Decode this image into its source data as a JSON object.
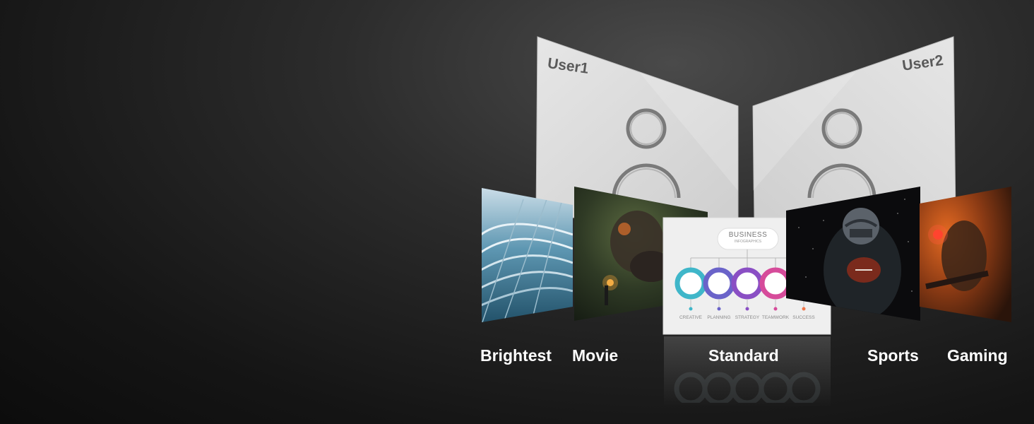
{
  "users": [
    {
      "label": "User1"
    },
    {
      "label": "User2"
    }
  ],
  "modes": [
    {
      "label": "Brightest",
      "image": "architecture-photo"
    },
    {
      "label": "Movie",
      "image": "fantasy-monster-painting"
    },
    {
      "label": "Standard",
      "image": "business-infographic"
    },
    {
      "label": "Sports",
      "image": "football-player-photo"
    },
    {
      "label": "Gaming",
      "image": "soldier-game-scene"
    }
  ],
  "infographic": {
    "title": "BUSINESS",
    "subtitle": "INFOGRAPHICS",
    "steps": [
      "CREATIVE",
      "PLANNING",
      "STRATEGY",
      "TEAMWORK",
      "SUCCESS"
    ],
    "colors": [
      "#3fb6c9",
      "#6a63c9",
      "#8a4fc4",
      "#d64b9a",
      "#f0774a"
    ]
  },
  "icons": [
    "user-profile-icon"
  ]
}
